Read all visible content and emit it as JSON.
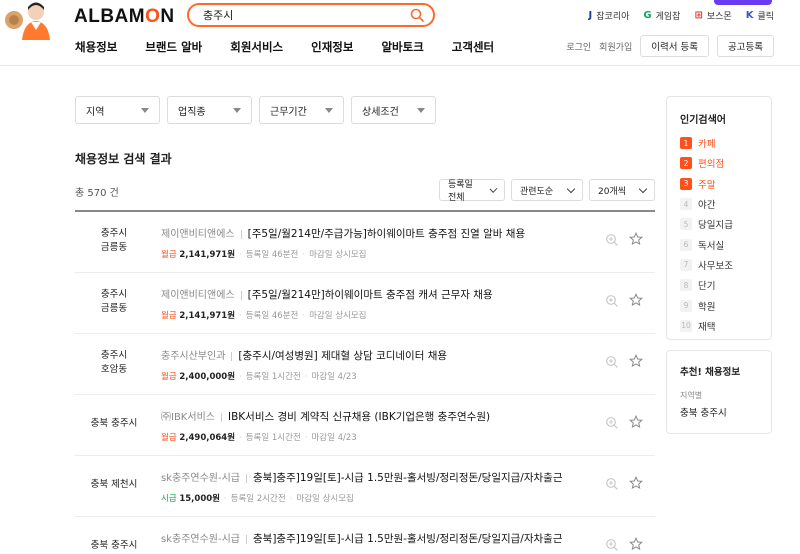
{
  "header": {
    "logo_left": "ALBAM",
    "logo_o": "O",
    "logo_right": "N",
    "search_value": "충주시",
    "partners": [
      {
        "icon": "J",
        "label": "잡코리아",
        "color": "#1d3a8a"
      },
      {
        "icon": "G",
        "label": "게임잡",
        "color": "#1aa35c"
      },
      {
        "icon": "⊞",
        "label": "보스몬",
        "color": "#e03a2a"
      },
      {
        "icon": "K",
        "label": "클릭",
        "color": "#3a55d4"
      }
    ],
    "nav": [
      "채용정보",
      "브랜드 알바",
      "회원서비스",
      "인재정보",
      "알바토크",
      "고객센터"
    ],
    "login": "로그인",
    "signup": "회원가입",
    "resume_btn": "이력서 등록",
    "post_btn": "공고등록"
  },
  "filters": [
    "지역",
    "업직종",
    "근무기간",
    "상세조건"
  ],
  "results": {
    "title": "채용정보 검색 결과",
    "total": "총 570 건",
    "sort_options": [
      "등록일 전체",
      "관련도순",
      "20개씩"
    ]
  },
  "jobs": [
    {
      "loc1": "충주시",
      "loc2": "금릉동",
      "company": "제이앤비티앤에스",
      "title": "[주5일/월214만/주급가능]하이웨이마트 충주점 진열 알바 채용",
      "pay_type": "월급",
      "pay_kind": "m",
      "pay": "2,141,971원",
      "posted": "등록일 46분전",
      "deadline": "마감일 상시모집"
    },
    {
      "loc1": "충주시",
      "loc2": "금릉동",
      "company": "제이앤비티앤에스",
      "title": "[주5일/월214만]하이웨이마트 충주점 캐셔 근무자 채용",
      "pay_type": "월급",
      "pay_kind": "m",
      "pay": "2,141,971원",
      "posted": "등록일 46분전",
      "deadline": "마감일 상시모집"
    },
    {
      "loc1": "충주시",
      "loc2": "호암동",
      "company": "충주시산부인과",
      "title": "[충주시/여성병원] 제대혈 상담 코디네이터 채용",
      "pay_type": "월급",
      "pay_kind": "m",
      "pay": "2,400,000원",
      "posted": "등록일 1시간전",
      "deadline": "마감일 4/23"
    },
    {
      "loc1": "충북 충주시",
      "loc2": "",
      "company": "㈜IBK서비스",
      "title": "IBK서비스 경비 계약직 신규채용 (IBK기업은행 충주연수원)",
      "pay_type": "월급",
      "pay_kind": "m",
      "pay": "2,490,064원",
      "posted": "등록일 1시간전",
      "deadline": "마감일 4/23"
    },
    {
      "loc1": "충북 제천시",
      "loc2": "",
      "company": "sk충주연수원-시급",
      "title": "충북]충주]19일[토]-시급 1.5만원-홀서빙/정리정돈/당일지급/자차출근",
      "pay_type": "시급",
      "pay_kind": "h",
      "pay": "15,000원",
      "posted": "등록일 2시간전",
      "deadline": "마감일 상시모집"
    },
    {
      "loc1": "충북 충주시",
      "loc2": "",
      "company": "sk충주연수원-시급",
      "title": "충북]충주]19일[토]-시급 1.5만원-홀서빙/정리정돈/당일지급/자차출근",
      "pay_type": "시급",
      "pay_kind": "h",
      "pay": "15,000원",
      "posted": "등록일 2시간전",
      "deadline": "마감일 상시모집"
    }
  ],
  "popular": {
    "title": "인기검색어",
    "items": [
      {
        "rank": "1",
        "label": "카페"
      },
      {
        "rank": "2",
        "label": "편의점"
      },
      {
        "rank": "3",
        "label": "주말"
      },
      {
        "rank": "4",
        "label": "야간"
      },
      {
        "rank": "5",
        "label": "당일지급"
      },
      {
        "rank": "6",
        "label": "독서실"
      },
      {
        "rank": "7",
        "label": "사무보조"
      },
      {
        "rank": "8",
        "label": "단기"
      },
      {
        "rank": "9",
        "label": "학원"
      },
      {
        "rank": "10",
        "label": "재택"
      }
    ]
  },
  "recommend": {
    "title": "추천! 채용정보",
    "label": "지역별",
    "value": "충북 충주시"
  }
}
